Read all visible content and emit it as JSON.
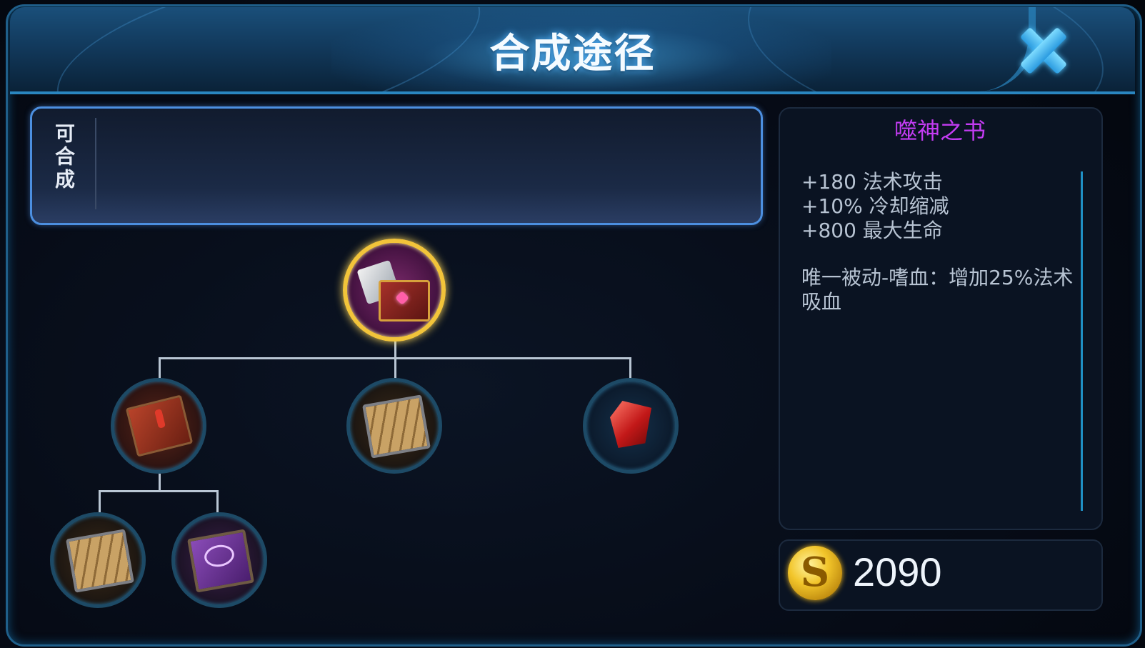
{
  "header": {
    "title": "合成途径"
  },
  "synthesis": {
    "label": "可合成"
  },
  "tree": {
    "root": {
      "icon": "book-of-devouring-icon"
    },
    "children": [
      {
        "icon": "red-spellbook-icon"
      },
      {
        "icon": "wooden-book-icon"
      },
      {
        "icon": "red-crystal-icon"
      }
    ],
    "grandchildren": [
      {
        "icon": "wooden-book-icon"
      },
      {
        "icon": "purple-tome-icon"
      }
    ]
  },
  "item": {
    "name": "噬神之书",
    "name_color": "#c33cf2",
    "stats": [
      "+180 法术攻击",
      "+10% 冷却缩减",
      "+800 最大生命"
    ],
    "passive": "唯一被动-嗜血：增加25%法术吸血",
    "price": "2090"
  },
  "colors": {
    "accent": "#2a86c0",
    "gold_ring": "#f2c43a",
    "panel_border": "#4c8fe0"
  }
}
